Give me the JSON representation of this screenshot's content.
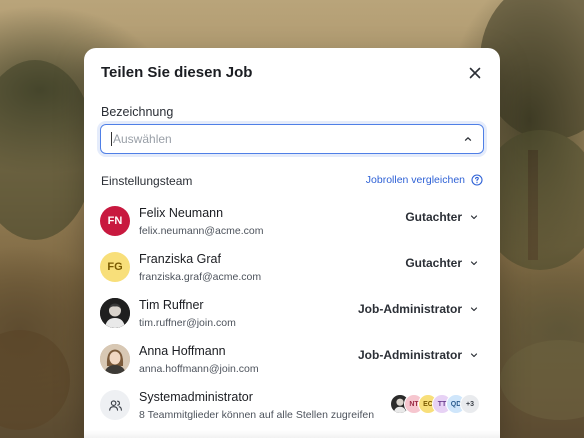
{
  "modal": {
    "title": "Teilen Sie diesen Job",
    "field_label": "Bezeichnung",
    "select_placeholder": "Auswählen",
    "team_label": "Einstellungsteam",
    "compare_link": "Jobrollen vergleichen"
  },
  "members": [
    {
      "name": "Felix Neumann",
      "email": "felix.neumann@acme.com",
      "role": "Gutachter",
      "initials": "FN",
      "avatar_bg": "#c8193f",
      "avatar_fg": "#ffffff"
    },
    {
      "name": "Franziska Graf",
      "email": "franziska.graf@acme.com",
      "role": "Gutachter",
      "initials": "FG",
      "avatar_bg": "#f8df7a",
      "avatar_fg": "#7a5a00"
    },
    {
      "name": "Tim Ruffner",
      "email": "tim.ruffner@join.com",
      "role": "Job-Administrator",
      "avatar": "photo-man"
    },
    {
      "name": "Anna Hoffmann",
      "email": "anna.hoffmann@join.com",
      "role": "Job-Administrator",
      "avatar": "photo-woman"
    }
  ],
  "system_admin": {
    "name": "Systemadministrator",
    "description": "8 Teammitglieder können auf alle Stellen zugreifen",
    "mini_avatars": [
      {
        "initials": "",
        "bg": "#2b2b2b",
        "fg": "#ffffff"
      },
      {
        "initials": "NT",
        "bg": "#f6c6cf",
        "fg": "#9b2c45"
      },
      {
        "initials": "EC",
        "bg": "#f8df7a",
        "fg": "#7a5a00"
      },
      {
        "initials": "TT",
        "bg": "#e7d2f5",
        "fg": "#6a3d8f"
      },
      {
        "initials": "QD",
        "bg": "#cfe6fb",
        "fg": "#2b5d8f"
      },
      {
        "initials": "+3",
        "bg": "#e9ebee",
        "fg": "#3b4048"
      }
    ]
  },
  "colors": {
    "accent": "#2f62d6",
    "focus_border": "#4f7fe6"
  },
  "icons": {
    "close": "close-icon",
    "chevron": "chevron-down-icon",
    "info": "info-icon",
    "users": "users-icon"
  }
}
